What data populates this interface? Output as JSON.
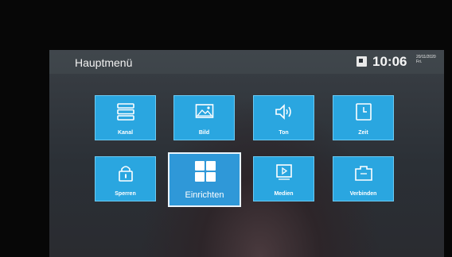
{
  "header": {
    "title": "Hauptmenü",
    "time": "10:06",
    "date": "20/11/2020",
    "weekday": "Fri."
  },
  "tiles": [
    {
      "label": "Kanal",
      "icon": "channel-list-icon"
    },
    {
      "label": "Bild",
      "icon": "picture-icon"
    },
    {
      "label": "Ton",
      "icon": "speaker-icon"
    },
    {
      "label": "Zeit",
      "icon": "clock-icon"
    },
    {
      "label": "Sperren",
      "icon": "lock-icon"
    },
    {
      "label": "Einrichten",
      "icon": "grid-icon",
      "focused": true
    },
    {
      "label": "Medien",
      "icon": "media-icon"
    },
    {
      "label": "Verbinden",
      "icon": "connect-icon"
    }
  ],
  "colors": {
    "tile": "#2aa6e0",
    "tile_focus_border": "#e9f4fb",
    "header_text": "#f2f2f2"
  }
}
